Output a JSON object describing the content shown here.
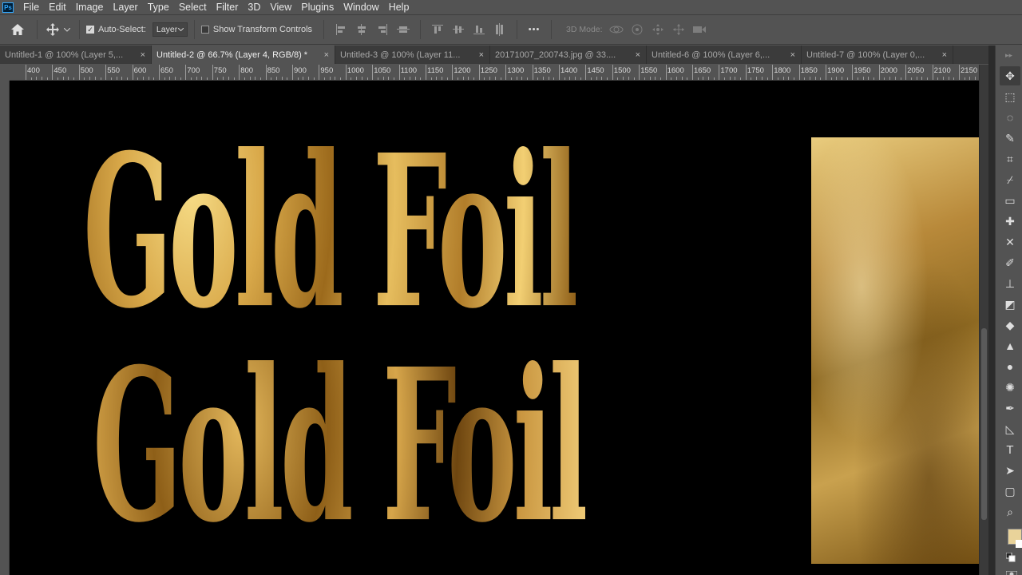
{
  "menu": [
    "File",
    "Edit",
    "Image",
    "Layer",
    "Type",
    "Select",
    "Filter",
    "3D",
    "View",
    "Plugins",
    "Window",
    "Help"
  ],
  "app_logo": "Ps",
  "options": {
    "auto_select_label": "Auto-Select:",
    "auto_select_checked": true,
    "auto_select_target": "Layer",
    "show_transform_label": "Show Transform Controls",
    "show_transform_checked": false,
    "more_label": "•••",
    "mode_3d_label": "3D Mode:"
  },
  "tabs": [
    {
      "label": "Untitled-1 @ 100% (Layer 5,...",
      "active": false
    },
    {
      "label": "Untitled-2 @ 66.7% (Layer 4, RGB/8) *",
      "active": true
    },
    {
      "label": "Untitled-3 @ 100% (Layer 11...",
      "active": false
    },
    {
      "label": "20171007_200743.jpg @ 33....",
      "active": false
    },
    {
      "label": "Untitled-6 @ 100% (Layer 6,...",
      "active": false
    },
    {
      "label": "Untitled-7 @ 100% (Layer 0,...",
      "active": false
    }
  ],
  "ruler": {
    "labels": [
      "400",
      "450",
      "500",
      "550",
      "600",
      "650",
      "700",
      "750",
      "800",
      "850",
      "900",
      "950",
      "1000",
      "1050",
      "1100",
      "1150",
      "1200",
      "1250",
      "1300",
      "1350",
      "1400",
      "1450",
      "1500",
      "1550",
      "1600",
      "1650",
      "1700",
      "1750",
      "1800",
      "1850",
      "1900",
      "1950",
      "2000",
      "2050",
      "2100",
      "2150"
    ]
  },
  "canvas": {
    "line1": "Gold Foil",
    "line2": "Gold Foil"
  },
  "tools": [
    "move-tool-icon",
    "marquee-tool-icon",
    "lasso-tool-icon",
    "quick-select-tool-icon",
    "crop-tool-icon",
    "eyedropper-tool-icon",
    "ruler-tool-icon",
    "healing-brush-tool-icon",
    "content-aware-move-tool-icon",
    "brush-tool-icon",
    "clone-stamp-tool-icon",
    "eraser-tool-icon",
    "paint-bucket-tool-icon",
    "sharpen-tool-icon",
    "dodge-tool-icon",
    "sponge-tool-icon",
    "pen-tool-icon",
    "path-selection-tool-icon",
    "type-tool-icon",
    "direct-selection-tool-icon",
    "rectangle-tool-icon",
    "zoom-tool-icon"
  ],
  "colors": {
    "foreground": "#e9d39a",
    "background": "#ffffff",
    "ui_bg": "#535353",
    "canvas_bg": "#000000"
  }
}
